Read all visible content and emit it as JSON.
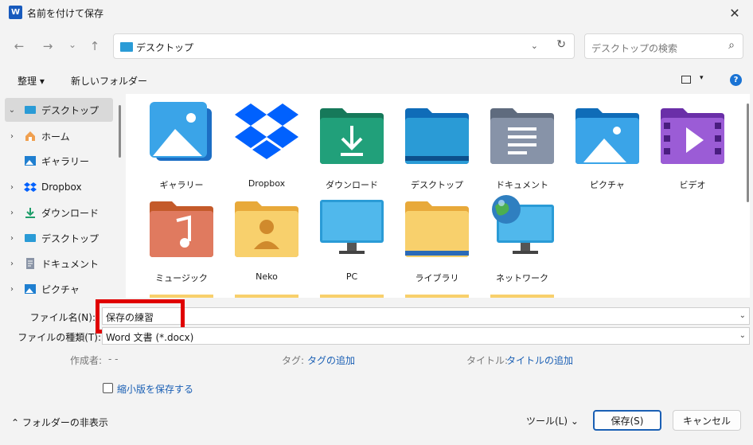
{
  "window": {
    "title": "名前を付けて保存",
    "app_icon_letter": "W",
    "close_glyph": "✕"
  },
  "nav": {
    "back": "←",
    "forward": "→",
    "recent": "⌄",
    "up": "↑",
    "address": "デスクトップ",
    "address_dropdown": "⌄",
    "refresh": "↻",
    "search_placeholder": "デスクトップの検索",
    "search_icon": "⌕"
  },
  "toolbar": {
    "organize": "整理 ▾",
    "new_folder": "新しいフォルダー",
    "view_dropdown": "▾",
    "help": "?"
  },
  "sidebar": {
    "items": [
      {
        "label": "デスクトップ",
        "chevron": "⌄",
        "icon": "desktop-icon",
        "selected": true
      },
      {
        "label": "ホーム",
        "chevron": "›",
        "icon": "home-icon",
        "selected": false
      },
      {
        "label": "ギャラリー",
        "chevron": "",
        "icon": "gallery-icon",
        "selected": false
      },
      {
        "label": "Dropbox",
        "chevron": "›",
        "icon": "dropbox-icon",
        "selected": false
      },
      {
        "label": "ダウンロード",
        "chevron": "›",
        "icon": "download-icon",
        "selected": false
      },
      {
        "label": "デスクトップ",
        "chevron": "›",
        "icon": "desktop-icon",
        "selected": false
      },
      {
        "label": "ドキュメント",
        "chevron": "›",
        "icon": "document-icon",
        "selected": false
      },
      {
        "label": "ピクチャ",
        "chevron": "›",
        "icon": "pictures-icon",
        "selected": false
      }
    ]
  },
  "files": [
    {
      "label": "ギャラリー",
      "icon": "gallery-icon"
    },
    {
      "label": "Dropbox",
      "icon": "dropbox-icon"
    },
    {
      "label": "ダウンロード",
      "icon": "download-folder-icon"
    },
    {
      "label": "デスクトップ",
      "icon": "desktop-folder-icon"
    },
    {
      "label": "ドキュメント",
      "icon": "documents-folder-icon"
    },
    {
      "label": "ピクチャ",
      "icon": "pictures-folder-icon"
    },
    {
      "label": "ビデオ",
      "icon": "videos-folder-icon"
    },
    {
      "label": "ミュージック",
      "icon": "music-folder-icon"
    },
    {
      "label": "Neko",
      "icon": "user-folder-icon"
    },
    {
      "label": "PC",
      "icon": "monitor-icon"
    },
    {
      "label": "ライブラリ",
      "icon": "library-folder-icon"
    },
    {
      "label": "ネットワーク",
      "icon": "network-icon"
    }
  ],
  "form": {
    "filename_label": "ファイル名(N):",
    "filename_value": "保存の練習",
    "filetype_label": "ファイルの種類(T):",
    "filetype_value": "Word 文書 (*.docx)",
    "author_key": "作成者:",
    "author_value": "- -",
    "tags_key": "タグ:",
    "tags_value": "タグの追加",
    "title_key": "タイトル:",
    "title_value": "タイトルの追加",
    "thumbnail_label": "縮小版を保存する"
  },
  "footer": {
    "hide_folders": "フォルダーの非表示",
    "hide_chevron": "⌃",
    "tools": "ツール(L)",
    "tools_dd": "⌄",
    "save": "保存(S)",
    "cancel": "キャンセル"
  },
  "colors": {
    "accent": "#1a5fb4",
    "highlight_box": "#e00000",
    "folder_yellow": "#f5c84c",
    "folder_blue": "#2a9bd6"
  }
}
